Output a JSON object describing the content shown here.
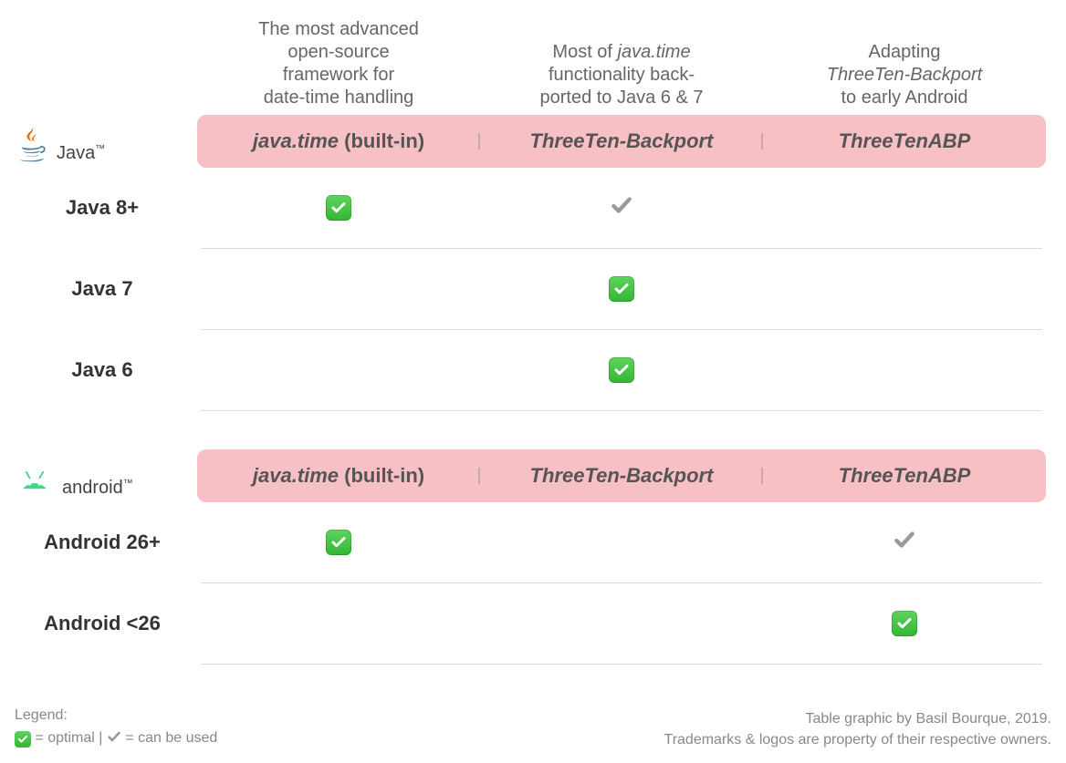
{
  "descriptions": {
    "col1_l1": "The most advanced",
    "col1_l2": "open-source",
    "col1_l3": "framework for",
    "col1_l4": "date-time handling",
    "col2_l1_pre": "Most of ",
    "col2_l1_it": "java.time",
    "col2_l2": "functionality back-",
    "col2_l3": "ported to Java 6 & 7",
    "col3_l1": "Adapting",
    "col3_l2_it": "ThreeTen-Backport",
    "col3_l3": "to early Android"
  },
  "columns": {
    "c1_it": "java.time",
    "c1_plain": " (built-in)",
    "c2": "ThreeTen-Backport",
    "c3": "ThreeTenABP"
  },
  "java": {
    "label": "Java",
    "tm": "™",
    "rows": [
      {
        "label": "Java 8+",
        "c1": "optimal",
        "c2": "usable",
        "c3": ""
      },
      {
        "label": "Java 7",
        "c1": "",
        "c2": "optimal",
        "c3": ""
      },
      {
        "label": "Java 6",
        "c1": "",
        "c2": "optimal",
        "c3": ""
      }
    ]
  },
  "android": {
    "label": "android",
    "tm": "™",
    "rows": [
      {
        "label": "Android 26+",
        "c1": "optimal",
        "c2": "",
        "c3": "usable"
      },
      {
        "label": "Android <26",
        "c1": "",
        "c2": "",
        "c3": "optimal"
      }
    ]
  },
  "legend": {
    "title": "Legend:",
    "opt": " = optimal",
    "sep": "   |  ",
    "use": " = can be used"
  },
  "credits": {
    "l1": "Table graphic by Basil Bourque, 2019.",
    "l2": "Trademarks & logos are property of their respective owners."
  },
  "chart_data": {
    "type": "table",
    "columns": [
      "java.time (built-in)",
      "ThreeTen-Backport",
      "ThreeTenABP"
    ],
    "column_descriptions": [
      "The most advanced open-source framework for date-time handling",
      "Most of java.time functionality back-ported to Java 6 & 7",
      "Adapting ThreeTen-Backport to early Android"
    ],
    "sections": [
      {
        "platform": "Java",
        "rows": [
          {
            "label": "Java 8+",
            "values": [
              "optimal",
              "can be used",
              null
            ]
          },
          {
            "label": "Java 7",
            "values": [
              null,
              "optimal",
              null
            ]
          },
          {
            "label": "Java 6",
            "values": [
              null,
              "optimal",
              null
            ]
          }
        ]
      },
      {
        "platform": "Android",
        "rows": [
          {
            "label": "Android 26+",
            "values": [
              "optimal",
              null,
              "can be used"
            ]
          },
          {
            "label": "Android <26",
            "values": [
              null,
              null,
              "optimal"
            ]
          }
        ]
      }
    ],
    "legend": {
      "optimal": "optimal",
      "usable": "can be used"
    }
  }
}
